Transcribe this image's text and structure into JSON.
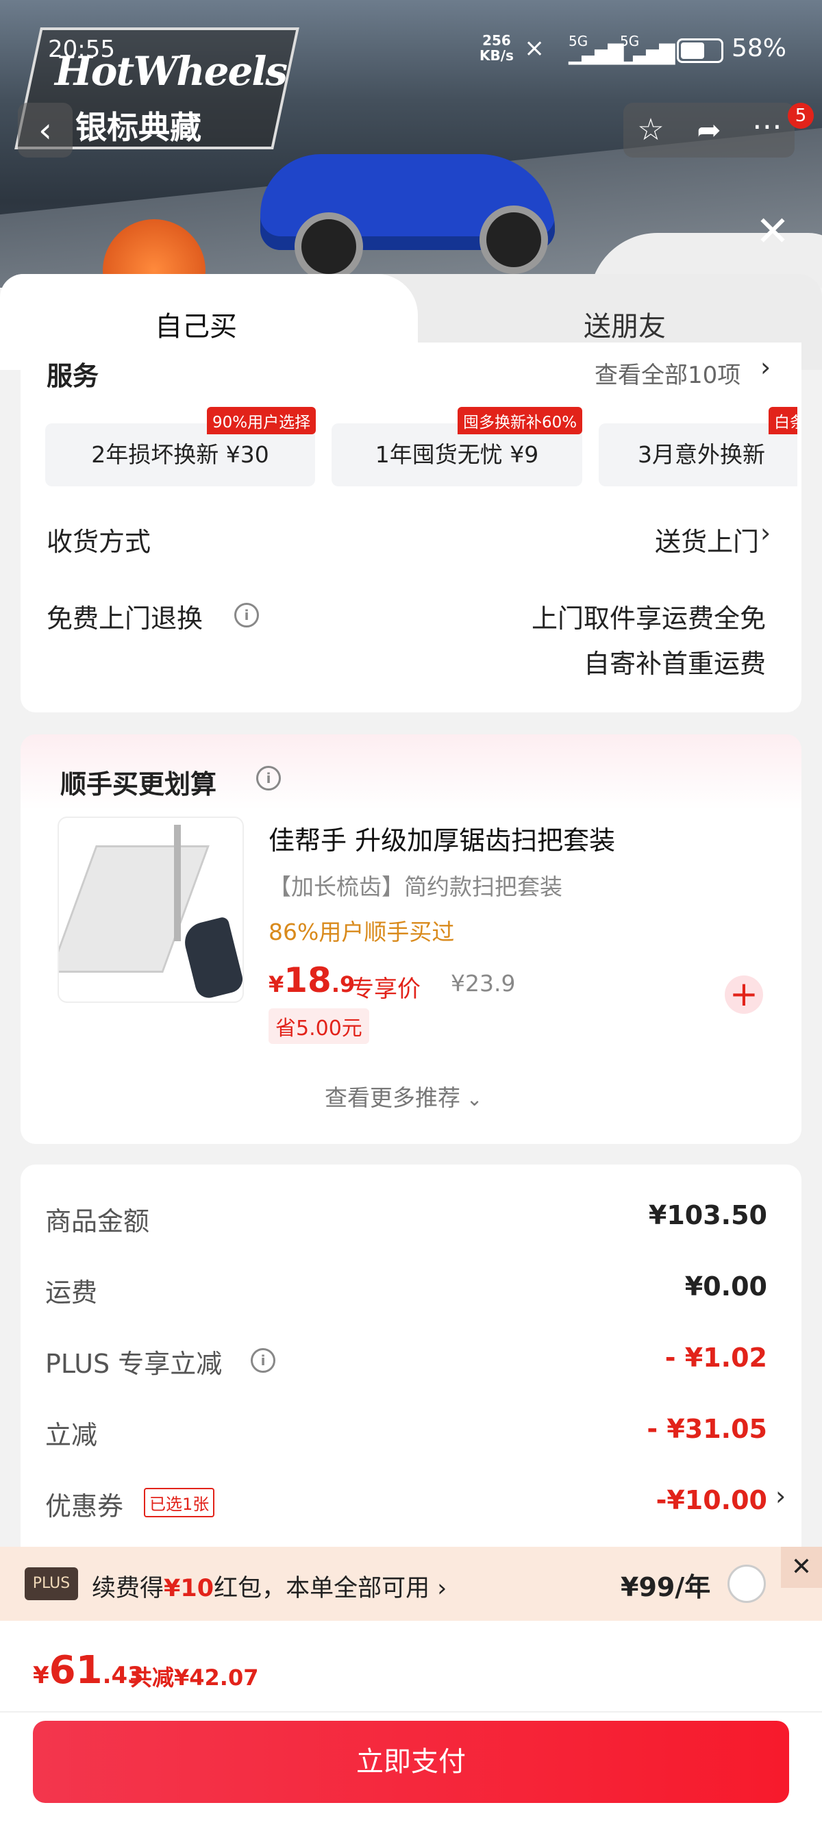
{
  "status_bar": {
    "time": "20:55",
    "net_speed": "256\nKB/s",
    "net_speed_top": "256",
    "net_speed_bottom": "KB/s",
    "signal1": "5G",
    "signal2": "5G",
    "battery": "58%"
  },
  "banner": {
    "brand": "HotWheels",
    "series": "银标典藏",
    "badge_count": "5"
  },
  "tabs": {
    "self": "自己买",
    "gift": "送朋友"
  },
  "services": {
    "title": "服务",
    "view_all": "查看全部10项",
    "items": [
      {
        "label": "2年损坏换新  ¥30",
        "tag": "90%用户选择"
      },
      {
        "label": "1年囤货无忧  ¥9",
        "tag": "囤多换新补60%"
      },
      {
        "label": "3月意外换新",
        "tag": "白条"
      }
    ]
  },
  "delivery": {
    "label": "收货方式",
    "value": "送货上门"
  },
  "return": {
    "label": "免费上门退换",
    "line1": "上门取件享运费全免",
    "line2": "自寄补首重运费"
  },
  "addon": {
    "section_title": "顺手买更划算",
    "product_name": "佳帮手 升级加厚锯齿扫把套装",
    "product_desc": "【加长梳齿】简约款扫把套装",
    "buy_rate": "86%用户顺手买过",
    "price_symbol": "¥",
    "price_int": "18",
    "price_dec": ".9",
    "price_tag": "专享价",
    "orig_price": "¥23.9",
    "save": "省5.00元",
    "more": "查看更多推荐"
  },
  "summary": {
    "rows": [
      {
        "label": "商品金额",
        "value": "¥103.50"
      },
      {
        "label": "运费",
        "value": "¥0.00"
      },
      {
        "label": "PLUS 专享立减",
        "value": "- ¥1.02"
      },
      {
        "label": "立减",
        "value": "- ¥31.05"
      },
      {
        "label": "优惠券",
        "value": "-¥10.00",
        "tag": "已选1张"
      }
    ]
  },
  "plus_bar": {
    "badge": "PLUS",
    "text_pre": "续费得",
    "text_amount": "¥10",
    "text_post": "红包，本单全部可用",
    "price": "¥99/年"
  },
  "total": {
    "symbol": "¥",
    "int": "61",
    "dec": ".43",
    "discount": "共减¥42.07"
  },
  "pay_button": "立即支付",
  "colors": {
    "accent": "#e2231a",
    "orange": "#d98a1c",
    "pay_gradient_start": "#f3364d",
    "pay_gradient_end": "#f71a2c"
  }
}
